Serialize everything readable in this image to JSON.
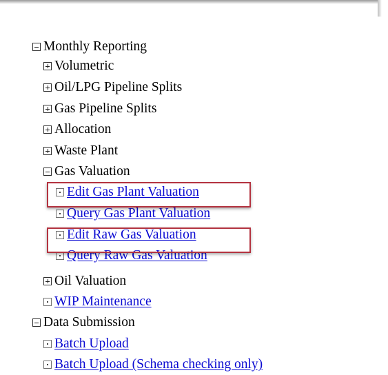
{
  "tree": {
    "monthly_reporting": {
      "label": "Monthly Reporting",
      "children": {
        "volumetric": "Volumetric",
        "oil_lpg_pipeline_splits": "Oil/LPG Pipeline Splits",
        "gas_pipeline_splits": "Gas Pipeline Splits",
        "allocation": "Allocation",
        "waste_plant": "Waste Plant",
        "gas_valuation": {
          "label": "Gas Valuation",
          "links": {
            "edit_gas_plant_valuation": "Edit Gas Plant Valuation",
            "query_gas_plant_valuation": "Query Gas Plant Valuation",
            "edit_raw_gas_valuation": "Edit Raw Gas Valuation",
            "query_raw_gas_valuation": "Query Raw Gas Valuation"
          }
        },
        "oil_valuation": "Oil Valuation",
        "wip_maintenance": "WIP Maintenance"
      }
    },
    "data_submission": {
      "label": "Data Submission",
      "links": {
        "batch_upload": "Batch Upload",
        "batch_upload_schema": "Batch Upload (Schema checking only)"
      }
    }
  },
  "colors": {
    "link": "#0a0ad2",
    "highlight_border": "#b3323f"
  },
  "icons": {
    "collapse": "minus-box-icon",
    "expand": "plus-box-icon",
    "leaf": "dotted-box-icon"
  }
}
